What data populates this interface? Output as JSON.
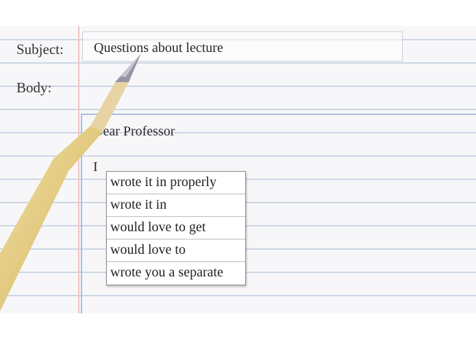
{
  "form": {
    "subject_label": "Subject:",
    "subject_value": "Questions about lecture",
    "body_label": "Body:"
  },
  "body": {
    "greeting": "Dear Professor",
    "typed_text": "I"
  },
  "suggestions": [
    "wrote it in properly",
    "wrote it in",
    "would love to get",
    "would love to",
    "wrote you a separate"
  ],
  "icons": {
    "pencil": "pencil-icon"
  },
  "colors": {
    "paper": "#f7f7f9",
    "ruled_line": "#cdd6e4",
    "margin_line": "#f0c4c4",
    "body_border": "#a9bde0",
    "pencil_body": "#e6d08a"
  }
}
